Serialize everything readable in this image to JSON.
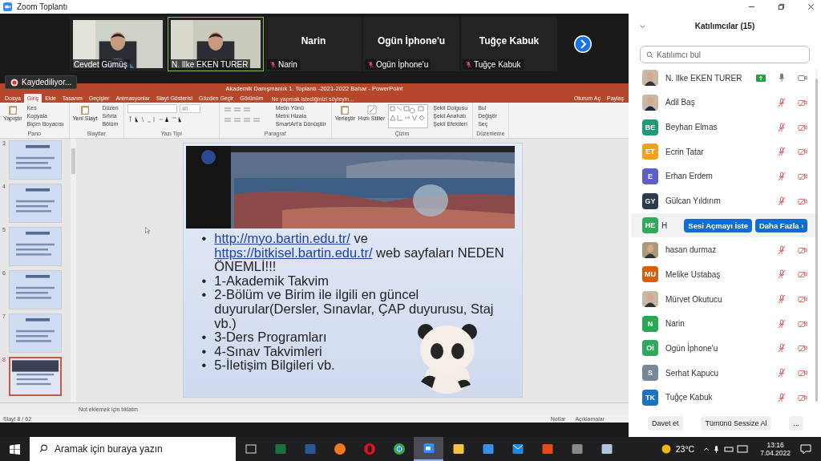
{
  "window": {
    "title": "Zoom Toplantı"
  },
  "video_tiles": [
    {
      "name": "Cevdet Gümüş",
      "kind": "video",
      "speaking": false,
      "muted": false
    },
    {
      "name": "N. Ilke EKEN TURER",
      "kind": "video",
      "speaking": true,
      "muted": false
    },
    {
      "name": "Narin",
      "kind": "avatar",
      "big_name": "Narin",
      "speaking": false,
      "muted": true
    },
    {
      "name": "Ogün İphone'u",
      "kind": "avatar",
      "big_name": "Ogün İphone'u",
      "speaking": false,
      "muted": true
    },
    {
      "name": "Tuğçe Kabuk",
      "kind": "avatar",
      "big_name": "Tuğçe Kabuk",
      "speaking": false,
      "muted": true
    }
  ],
  "recording": {
    "label": "Kaydediliyor..."
  },
  "powerpoint": {
    "title": "Akademik Danışmanlık 1. Toplantı -2021-2022 Bahar - PowerPoint",
    "tabs": [
      {
        "label": "Dosya",
        "selected": false
      },
      {
        "label": "Giriş",
        "selected": true
      },
      {
        "label": "Ekle",
        "selected": false
      },
      {
        "label": "Tasarım",
        "selected": false
      },
      {
        "label": "Geçişler",
        "selected": false
      },
      {
        "label": "Animasyonlar",
        "selected": false
      },
      {
        "label": "Slayt Gösterisi",
        "selected": false
      },
      {
        "label": "Gözden Geçir",
        "selected": false
      },
      {
        "label": "Görünüm",
        "selected": false
      }
    ],
    "tell_me": "Ne yapmak istediğinizi söyleyin...",
    "sign_in": "Oturum Aç",
    "share": "Paylaş",
    "groups": [
      {
        "label": "Pano",
        "big": "Yapıştır",
        "items": [
          "Kes",
          "Kopyala",
          "Biçim Boyacısı"
        ]
      },
      {
        "label": "Slaytlar",
        "big": "Yeni Slayt",
        "items": [
          "Düzen",
          "Sıfırla",
          "Bölüm"
        ]
      },
      {
        "label": "Yazı Tipi",
        "kind": "font",
        "size": "40"
      },
      {
        "label": "Paragraf",
        "kind": "paragraph",
        "items": [
          "Metin Yönü",
          "Metni Hizala",
          "SmartArt'a Dönüştür"
        ]
      },
      {
        "label": "Çizim",
        "kind": "drawing",
        "big": "Yerleştir",
        "big2": "Hızlı Stiller",
        "items": [
          "Şekil Dolgusu",
          "Şekil Anahatı",
          "Şekil Efektleri"
        ]
      },
      {
        "label": "Düzenleme",
        "items": [
          "Bul",
          "Değiştir",
          "Seç"
        ]
      }
    ],
    "thumbnails": [
      {
        "number": "3",
        "selected": false
      },
      {
        "number": "4",
        "selected": false
      },
      {
        "number": "5",
        "selected": false
      },
      {
        "number": "6",
        "selected": false
      },
      {
        "number": "7",
        "selected": false
      },
      {
        "number": "8",
        "selected": true
      }
    ],
    "slide": {
      "bullets": [
        {
          "marker": "•",
          "segments": [
            {
              "kind": "link",
              "text": "http://myo.bartin.edu.tr/"
            },
            {
              "kind": "text",
              "text": " ve "
            },
            {
              "kind": "link",
              "text": "https://bitkisel.bartin.edu.tr/"
            },
            {
              "kind": "text",
              "text": " web sayfaları NEDEN ÖNEMLİ!!!"
            }
          ]
        },
        {
          "marker": "•",
          "segments": [
            {
              "kind": "text",
              "text": "1-Akademik Takvim"
            }
          ]
        },
        {
          "marker": "•",
          "segments": [
            {
              "kind": "text",
              "text": "2-Bölüm ve Birim ile ilgili en güncel duyurular(Dersler, Sınavlar, ÇAP duyurusu, Staj vb.)"
            }
          ]
        },
        {
          "marker": "•",
          "segments": [
            {
              "kind": "text",
              "text": "3-Ders Programları"
            }
          ]
        },
        {
          "marker": "•",
          "segments": [
            {
              "kind": "text",
              "text": "4-Sınav Takvimleri"
            }
          ]
        },
        {
          "marker": "•",
          "segments": [
            {
              "kind": "text",
              "text": "5-İletişim Bilgileri vb."
            }
          ]
        }
      ]
    },
    "notes_placeholder": "Not eklemek için tıklatın",
    "status": {
      "slide": "Slayt 8 / 62",
      "notes": "Notlar",
      "comments": "Açıklamalar"
    }
  },
  "participants": {
    "title": "Katılımcılar (15)",
    "search_placeholder": "Katılımcı bul",
    "rows": [
      {
        "name": "N. Ilke EKEN TURER",
        "muted": false,
        "video": true,
        "sharing": true
      },
      {
        "name": "Adil Baş",
        "muted": true,
        "video": false,
        "sharing": false
      },
      {
        "name": "Beyhan Elmas",
        "kind": "initials",
        "initials": "BE",
        "color": "#1c9c78",
        "muted": true,
        "video": false,
        "sharing": false
      },
      {
        "name": "Ecrin Tatar",
        "kind": "initials",
        "initials": "ET",
        "color": "#f2a219",
        "muted": true,
        "video": false,
        "sharing": false
      },
      {
        "name": "Erhan Erdem",
        "kind": "initials",
        "initials": "E",
        "color": "#5b5fc7",
        "muted": true,
        "video": false,
        "sharing": false
      },
      {
        "name": "Gülcan Yıldırım",
        "kind": "initials",
        "initials": "GY",
        "color": "#2b3c4e",
        "muted": true,
        "video": false,
        "sharing": false
      },
      {
        "name": "H",
        "kind": "initials",
        "initials": "HE",
        "color": "#2eaa5c",
        "hover_actions": [
          "Sesi Açmayı İste",
          "Daha Fazla ›"
        ]
      },
      {
        "name": "hasan durmaz",
        "muted": true,
        "video": false,
        "sharing": false
      },
      {
        "name": "Melike Ustabaş",
        "kind": "initials",
        "initials": "MU",
        "color": "#d65f0e",
        "muted": true,
        "video": false,
        "sharing": false
      },
      {
        "name": "Mürvet Okutucu",
        "muted": true,
        "video": false,
        "sharing": false
      },
      {
        "name": "Narin",
        "kind": "initials",
        "initials": "N",
        "color": "#27a853",
        "muted": true,
        "video": false,
        "sharing": false
      },
      {
        "name": "Ogün İphone'u",
        "kind": "initials",
        "initials": "Oİ",
        "color": "#2eaa5c",
        "muted": true,
        "video": false,
        "sharing": false
      },
      {
        "name": "Serhat Kapucu",
        "kind": "initials",
        "initials": "S",
        "color": "#778899",
        "muted": true,
        "video": false,
        "sharing": false
      },
      {
        "name": "Tuğçe Kabuk",
        "kind": "initials",
        "initials": "TK",
        "color": "#1a72c0",
        "muted": true,
        "video": false,
        "sharing": false
      }
    ],
    "buttons": [
      "Davet et",
      "Tümünü Sessize Al",
      "..."
    ]
  },
  "taskbar": {
    "search_placeholder": "Aramak için buraya yazın",
    "apps": [
      {
        "kind": "taskview",
        "selected": false
      },
      {
        "kind": "excel",
        "selected": false
      },
      {
        "kind": "word",
        "selected": false
      },
      {
        "kind": "firefox",
        "selected": false
      },
      {
        "kind": "opera",
        "selected": false
      },
      {
        "kind": "chrome",
        "selected": false
      },
      {
        "kind": "zoom",
        "selected": true
      },
      {
        "kind": "folder",
        "selected": false
      },
      {
        "kind": "store",
        "selected": false
      },
      {
        "kind": "mail",
        "selected": false
      },
      {
        "kind": "office",
        "selected": false
      },
      {
        "kind": "calculator",
        "selected": false
      },
      {
        "kind": "paint",
        "selected": false
      }
    ],
    "weather": "23°C",
    "time": "13:16",
    "date": "7.04.2022"
  }
}
